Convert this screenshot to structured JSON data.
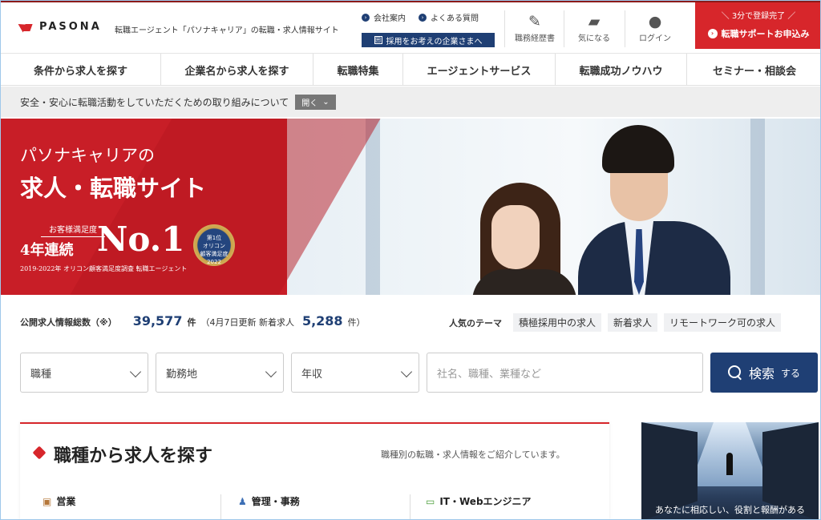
{
  "brand": {
    "logo": "PASONA",
    "tagline": "転職エージェント「パソナキャリア」の転職・求人情報サイト"
  },
  "util_links": [
    "会社案内",
    "よくある質問"
  ],
  "corp_button": "採用をお考えの企業さまへ",
  "header_icons": [
    {
      "label": "職務経歴書",
      "icon": "resume-icon"
    },
    {
      "label": "気になる",
      "icon": "folder-icon"
    },
    {
      "label": "ログイン",
      "icon": "user-icon"
    }
  ],
  "cta": {
    "top": "3分で登録完了",
    "bottom": "転職サポートお申込み"
  },
  "nav": [
    "条件から求人を探す",
    "企業名から求人を探す",
    "転職特集",
    "エージェントサービス",
    "転職成功ノウハウ",
    "セミナー・相談会"
  ],
  "notice": {
    "text": "安全・安心に転職活動をしていただくための取り組みについて",
    "toggle": "開く"
  },
  "hero": {
    "line1": "パソナキャリアの",
    "line2": "求人・転職サイト",
    "satisfaction": "お客様満足度",
    "years": "4年連続",
    "no1": "No.1",
    "note": "2019-2022年 オリコン顧客満足度調査 転職エージェント",
    "medal_rank": "第1位",
    "medal_brand": "オリコン",
    "medal_sub": "顧客満足度",
    "medal_year": "2022"
  },
  "stats": {
    "label": "公開求人情報総数（※）",
    "total": "39,577",
    "unit": "件",
    "update": "（4月7日更新 新着求人",
    "new_count": "5,288",
    "new_unit": "件）"
  },
  "themes": {
    "title": "人気のテーマ",
    "tags": [
      "積極採用中の求人",
      "新着求人",
      "リモートワーク可の求人"
    ]
  },
  "search": {
    "job_type": "職種",
    "location": "勤務地",
    "salary": "年収",
    "keyword_placeholder": "社名、職種、業種など",
    "button": "検索",
    "button_suffix": "する"
  },
  "section": {
    "title": "職種から求人を探す",
    "subtitle": "職種別の転職・求人情報をご紹介しています。",
    "categories": [
      "営業",
      "管理・事務",
      "IT・Webエンジニア"
    ]
  },
  "side_banner": {
    "caption": "あなたに相応しい、役割と報酬がある"
  },
  "colors": {
    "brand_red": "#d7262b",
    "navy": "#1f3f74"
  }
}
